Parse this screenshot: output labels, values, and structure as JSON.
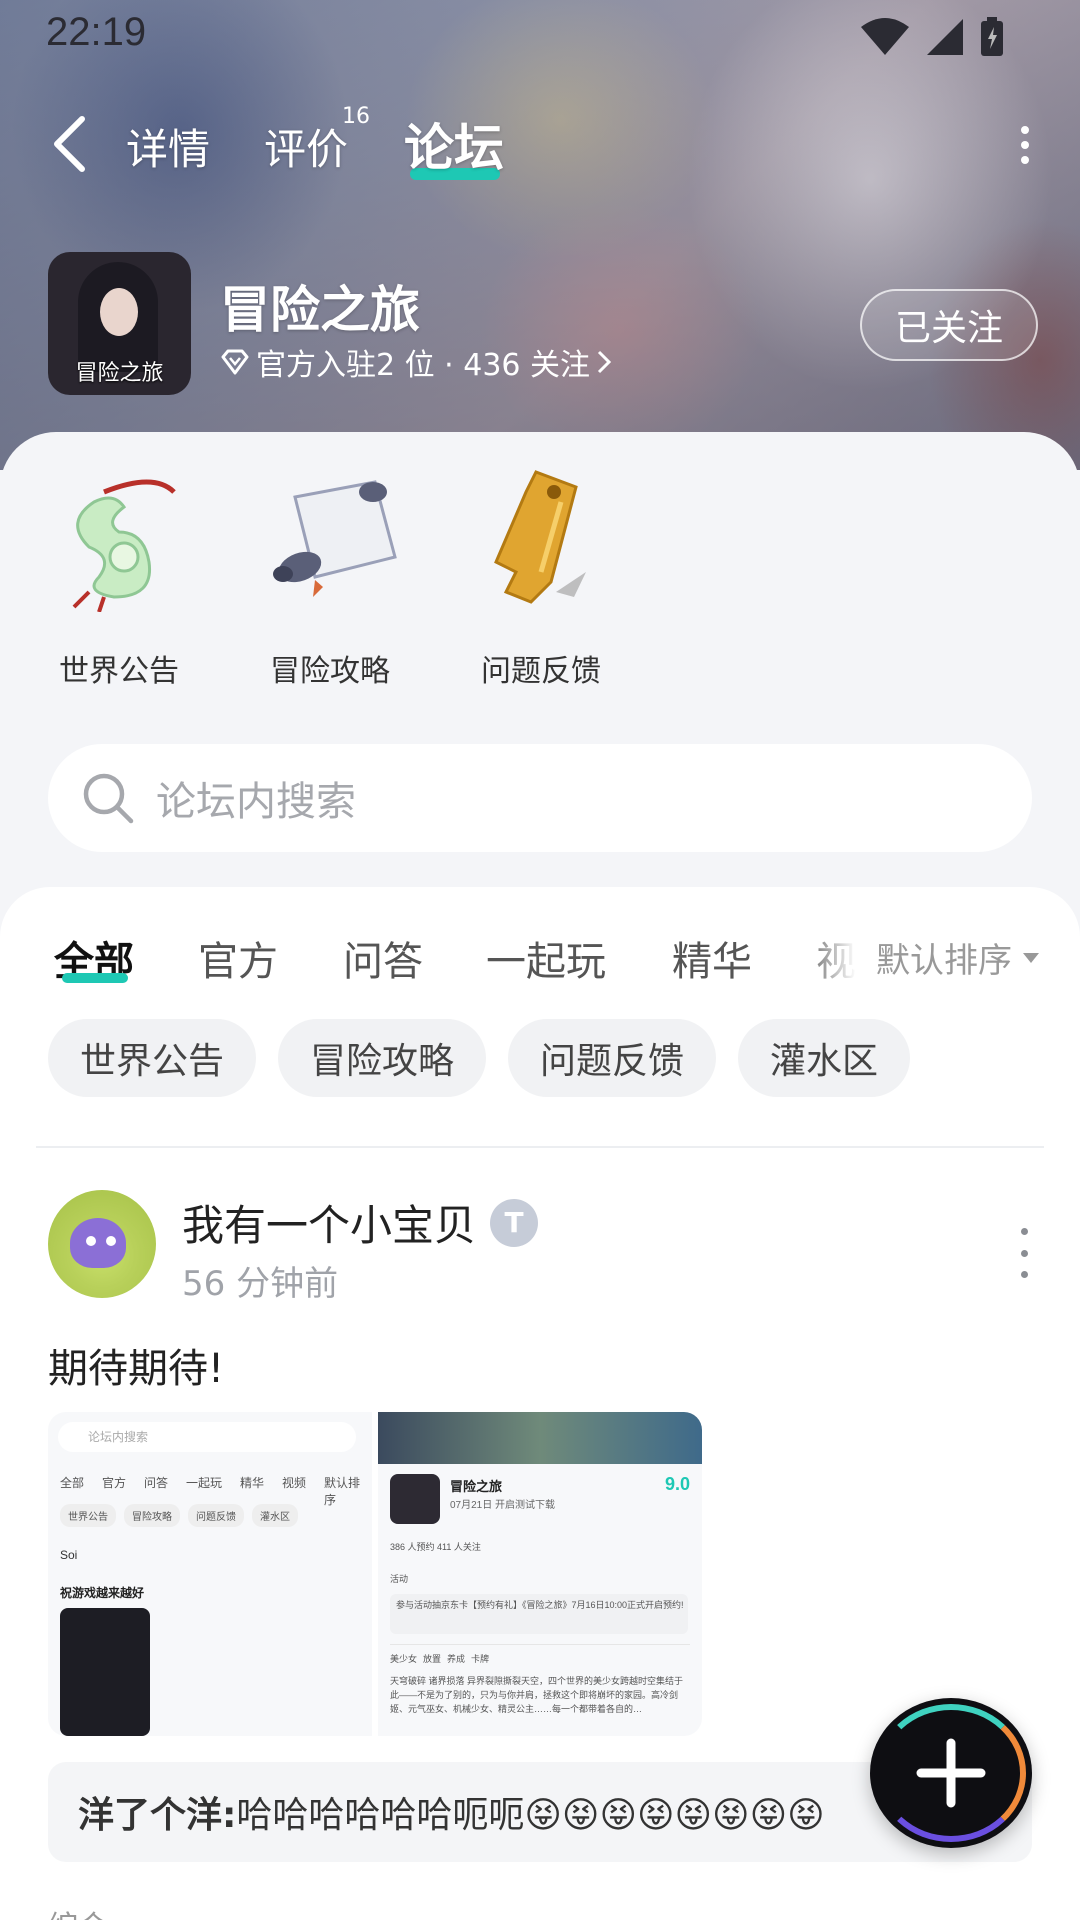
{
  "status": {
    "time": "22:19"
  },
  "nav": {
    "tabs": [
      {
        "label": "详情"
      },
      {
        "label": "评价",
        "badge": "16"
      },
      {
        "label": "论坛"
      }
    ]
  },
  "game": {
    "icon_text": "冒险之旅",
    "title": "冒险之旅",
    "subtitle": "官方入驻2 位 · 436 关注",
    "follow_label": "已关注"
  },
  "categories": [
    {
      "label": "世界公告"
    },
    {
      "label": "冒险攻略"
    },
    {
      "label": "问题反馈"
    }
  ],
  "search": {
    "placeholder": "论坛内搜索"
  },
  "feed_tabs": [
    "全部",
    "官方",
    "问答",
    "一起玩",
    "精华",
    "视"
  ],
  "sort_label": "默认排序",
  "chips": [
    "世界公告",
    "冒险攻略",
    "问题反馈",
    "灌水区"
  ],
  "post": {
    "author": "我有一个小宝贝",
    "badge_text": "T",
    "time": "56 分钟前",
    "text": "期待期待!",
    "thumb1": {
      "search": "论坛内搜索",
      "tabs": [
        "全部",
        "官方",
        "问答",
        "一起玩",
        "精华",
        "视频",
        "默认排序"
      ],
      "chips": [
        "世界公告",
        "冒险攻略",
        "问题反馈",
        "灌水区"
      ],
      "user": "Soi",
      "post_text": "祝游戏越来越好"
    },
    "thumb2": {
      "title": "冒险之旅",
      "date": "07月21日 开启测试下载",
      "score": "9.0",
      "stats": "386 人预约   411 人关注",
      "activity": "活动",
      "notice": "参与活动抽京东卡【预约有礼】《冒险之旅》7月16日10:00正式开启预约!",
      "tags": [
        "美少女",
        "放置",
        "养成",
        "卡牌"
      ],
      "desc": "天穹破碎 诸界损落 异界裂隙撕裂天空，四个世界的美少女跨越时空集结于此——不是为了别的，只为与你并肩，拯救这个即将崩坏的家园。高冷剑姬、元气巫女、机械少女、精灵公主……每一个都带着各自的…"
    },
    "reply_user": "洋了个洋:",
    "reply_text": "哈哈哈哈哈哈呃呃😝😝😝😝😝😝😝😝"
  },
  "bottom_peek": "综合",
  "colors": {
    "accent": "#1ec8b4"
  }
}
